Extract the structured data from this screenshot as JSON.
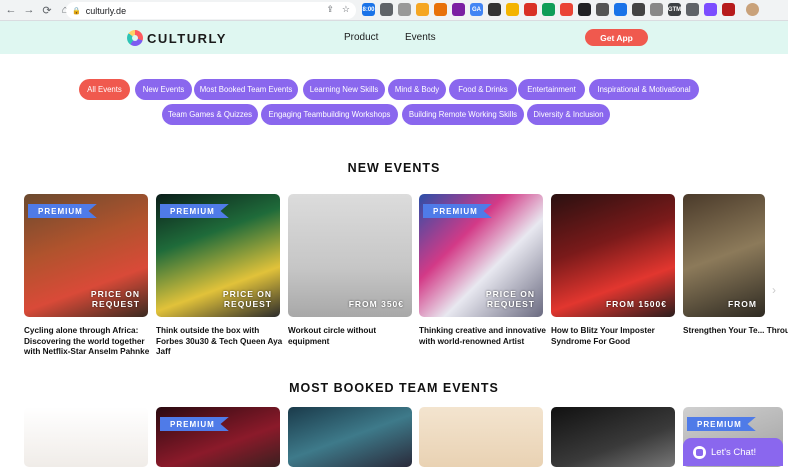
{
  "browser": {
    "url": "culturly.de",
    "extensions": [
      {
        "label": "8:00",
        "color": "#1a73e8"
      },
      {
        "label": "",
        "color": "#5f6368"
      },
      {
        "label": "",
        "color": "#999999"
      },
      {
        "label": "",
        "color": "#f5a623"
      },
      {
        "label": "",
        "color": "#e8710a"
      },
      {
        "label": "",
        "color": "#7b1fa2"
      },
      {
        "label": "GA",
        "color": "#4285f4"
      },
      {
        "label": "",
        "color": "#333333"
      },
      {
        "label": "",
        "color": "#f4b400"
      },
      {
        "label": "",
        "color": "#d93025"
      },
      {
        "label": "",
        "color": "#0f9d58"
      },
      {
        "label": "",
        "color": "#ea4335"
      },
      {
        "label": "",
        "color": "#202124"
      },
      {
        "label": "",
        "color": "#555555"
      },
      {
        "label": "",
        "color": "#1a73e8"
      },
      {
        "label": "",
        "color": "#444444"
      },
      {
        "label": "",
        "color": "#888888"
      },
      {
        "label": "GTM",
        "color": "#3c4043"
      },
      {
        "label": "",
        "color": "#5f6368"
      },
      {
        "label": "",
        "color": "#7c4dff"
      },
      {
        "label": "",
        "color": "#b71c1c"
      }
    ]
  },
  "site": {
    "brand": "CULTURLY",
    "nav": {
      "product": "Product",
      "events": "Events"
    },
    "get_app": "Get App"
  },
  "filters": [
    "All Events",
    "New Events",
    "Most Booked Team Events",
    "Learning New Skills",
    "Mind & Body",
    "Food & Drinks",
    "Entertainment",
    "Inspirational & Motivational",
    "Team Games & Quizzes",
    "Engaging Teambuilding Workshops",
    "Building Remote Working Skills",
    "Diversity & Inclusion"
  ],
  "new_events": {
    "title": "NEW EVENTS",
    "badge": "PREMIUM",
    "cards": [
      {
        "title": "Cycling alone through Africa: Discovering the world together with Netflix-Star Anselm Pahnke",
        "price": "PRICE ON\nREQUEST",
        "premium": true
      },
      {
        "title": "Think outside the box with Forbes 30u30 & Tech Queen Aya Jaff",
        "price": "PRICE ON\nREQUEST",
        "premium": true
      },
      {
        "title": "Workout circle without equipment",
        "price": "FROM 350€",
        "premium": false
      },
      {
        "title": "Thinking creative and innovative with world-renowned Artist",
        "price": "PRICE ON\nREQUEST",
        "premium": true
      },
      {
        "title": "How to Blitz Your Imposter Syndrome For Good",
        "price": "FROM 1500€",
        "premium": false
      },
      {
        "title": "Strengthen Your Te... Through Candid Le...",
        "price": "FROM",
        "premium": false
      }
    ]
  },
  "most_booked": {
    "title": "MOST BOOKED TEAM EVENTS",
    "badge": "PREMIUM"
  },
  "chat": {
    "label": "Let's Chat!"
  }
}
